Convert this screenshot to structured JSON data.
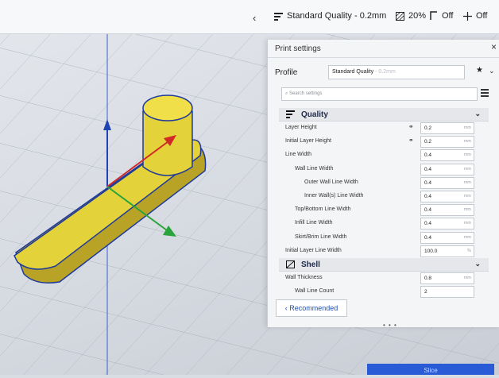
{
  "topbar": {
    "back_glyph": "‹",
    "profile_label": "Standard Quality - 0.2mm",
    "infill_label": "20%",
    "support_label": "Off",
    "adhesion_label": "Off"
  },
  "panel": {
    "title": "Print settings",
    "close_glyph": "×",
    "profile_label": "Profile",
    "profile_value": "Standard Quality",
    "profile_suffix": "- 0.2mm",
    "search_placeholder": "Search settings",
    "recommended_label": "Recommended",
    "grip_label": "• • •"
  },
  "sections": {
    "quality": "Quality",
    "shell": "Shell"
  },
  "settings": [
    {
      "label": "Layer Height",
      "value": "0.2",
      "unit": "mm",
      "linked": true
    },
    {
      "label": "Initial Layer Height",
      "value": "0.2",
      "unit": "mm",
      "linked": true
    },
    {
      "label": "Line Width",
      "value": "0.4",
      "unit": "mm"
    },
    {
      "label": "Wall Line Width",
      "value": "0.4",
      "unit": "mm"
    },
    {
      "label": "Outer Wall Line Width",
      "value": "0.4",
      "unit": "mm"
    },
    {
      "label": "Inner Wall(s) Line Width",
      "value": "0.4",
      "unit": "mm"
    },
    {
      "label": "Top/Bottom Line Width",
      "value": "0.4",
      "unit": "mm"
    },
    {
      "label": "Infill Line Width",
      "value": "0.4",
      "unit": "mm"
    },
    {
      "label": "Skirt/Brim Line Width",
      "value": "0.4",
      "unit": "mm"
    },
    {
      "label": "Initial Layer Line Width",
      "value": "100.0",
      "unit": "%"
    }
  ],
  "shell_settings": [
    {
      "label": "Wall Thickness",
      "value": "0.8",
      "unit": "mm"
    },
    {
      "label": "Wall Line Count",
      "value": "2"
    }
  ],
  "slice_button": "Slice",
  "colors": {
    "model_fill": "#e3d23a",
    "model_outline": "#1f3a9a",
    "axis_x": "#d12828",
    "axis_y": "#1f43b3",
    "axis_z": "#2aa43a",
    "accent": "#2a5bd7"
  }
}
